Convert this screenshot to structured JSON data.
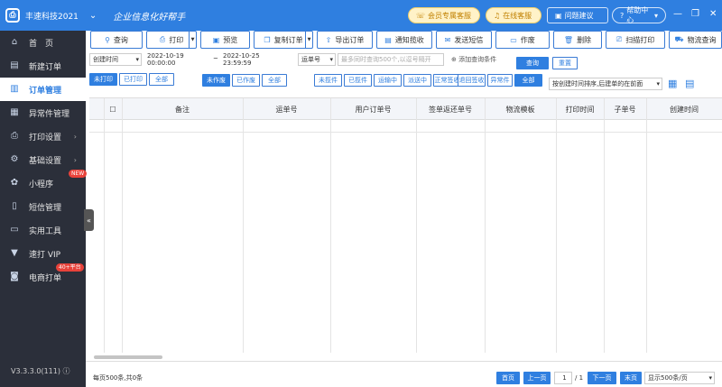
{
  "titlebar": {
    "app_title": "丰速科技2021",
    "slogan": "企业信息化好帮手",
    "member_service": "会员专属客服",
    "online_service": "在线客服",
    "feedback": "问题建议",
    "help_center": "帮助中心"
  },
  "sidebar": {
    "items": [
      {
        "label": "首　页",
        "icon": "home-icon"
      },
      {
        "label": "新建订单",
        "icon": "new-order-icon"
      },
      {
        "label": "订单管理",
        "icon": "order-icon"
      },
      {
        "label": "异常件管理",
        "icon": "exception-icon"
      },
      {
        "label": "打印设置",
        "icon": "print-icon"
      },
      {
        "label": "基础设置",
        "icon": "settings-icon"
      },
      {
        "label": "小程序",
        "icon": "mini-program-icon"
      },
      {
        "label": "短信管理",
        "icon": "sms-icon"
      },
      {
        "label": "实用工具",
        "icon": "tools-icon"
      },
      {
        "label": "速打 VIP",
        "icon": "vip-icon"
      },
      {
        "label": "电商打单",
        "icon": "ecommerce-icon"
      }
    ],
    "badge_new": "NEW",
    "badge_platform": "40+平台",
    "version": "V3.3.3.0(111)"
  },
  "toolbar": {
    "query": "查询",
    "print": "打印",
    "preview": "预览",
    "copy_order": "复制订单",
    "export_order": "导出订单",
    "notify_pickup": "通知揽收",
    "send_sms": "发送短信",
    "void": "作废",
    "delete": "删除",
    "scan_print": "扫描打印",
    "logistics_query": "物流查询"
  },
  "filters": {
    "time_field": "创建时间",
    "start_time": "2022-10-19 00:00:00",
    "tilde": "~",
    "end_time": "2022-10-25 23:59:59",
    "waybill_field": "运单号",
    "waybill_placeholder": "最多同时查询500个,以逗号隔开",
    "add_condition": "添加查询条件",
    "query": "查询",
    "reset": "重置",
    "print_status": [
      "未打印",
      "已打印",
      "全部"
    ],
    "void_status": [
      "未作废",
      "已作废",
      "全部"
    ],
    "track_status": [
      "未揽件",
      "已揽件",
      "运输中",
      "派送中",
      "正常签收",
      "退回签收",
      "异常件",
      "全部"
    ],
    "sort_option": "按创建时间排序,后建单的在前面"
  },
  "table": {
    "columns": [
      "备注",
      "运单号",
      "用户订单号",
      "签单返还单号",
      "物流模板",
      "打印时间",
      "子单号",
      "创建时间"
    ]
  },
  "footer": {
    "summary": "每页500条,共0条",
    "first": "首页",
    "prev": "上一页",
    "page": "1",
    "total": "/ 1",
    "next": "下一页",
    "last": "末页",
    "page_size": "显示500条/页"
  },
  "colors": {
    "accent": "#2f7fe0",
    "sidebar": "#2b2f3a"
  }
}
